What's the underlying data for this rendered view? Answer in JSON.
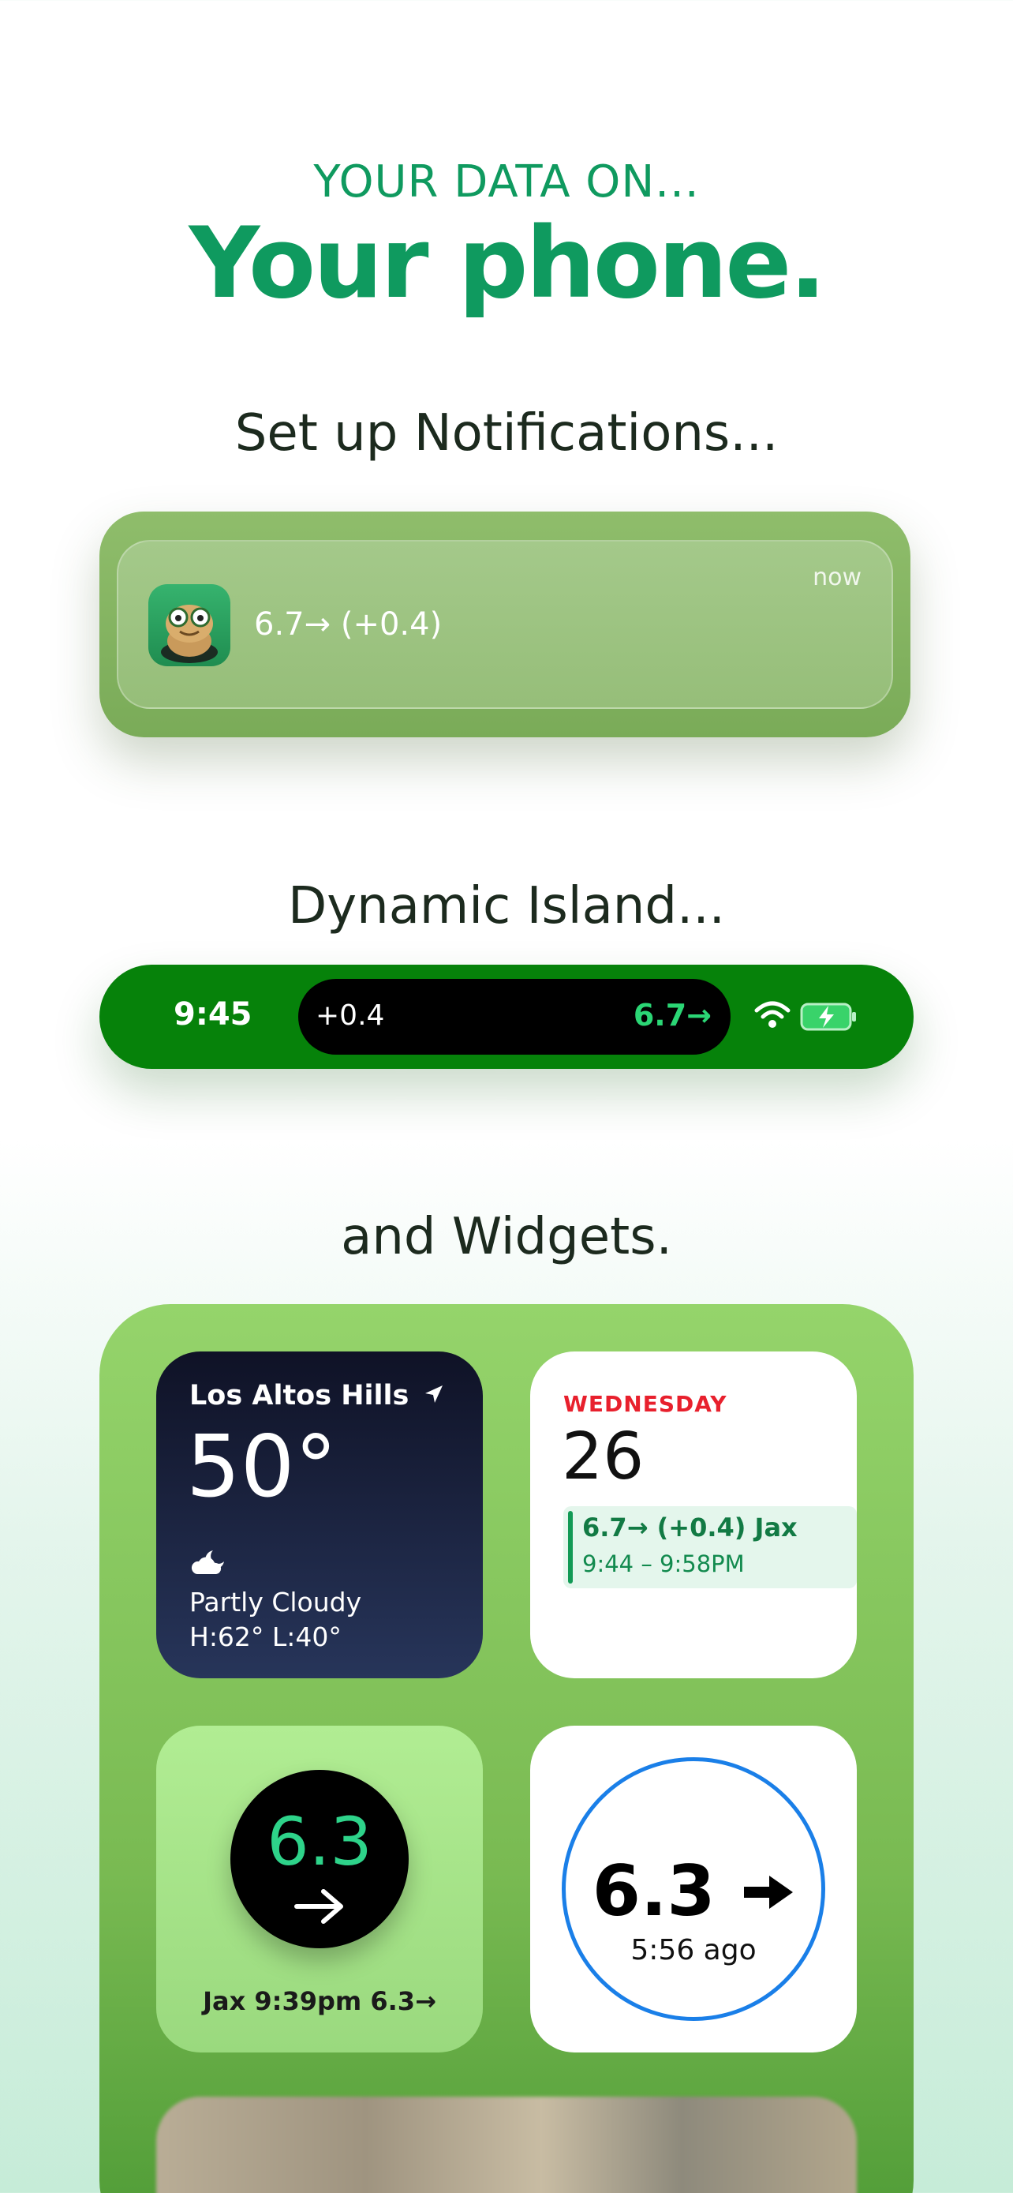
{
  "hero": {
    "kicker": "YOUR DATA ON...",
    "headline": "Your phone."
  },
  "sections": {
    "notifications": "Set up Notifications...",
    "dynamic_island": "Dynamic Island...",
    "widgets": "and Widgets."
  },
  "notification": {
    "app_icon": "frog-mascot-icon",
    "message": "6.7→ (+0.4)",
    "time": "now"
  },
  "island": {
    "clock": "9:45",
    "left_value": "+0.4",
    "right_value": "6.7→",
    "icons": [
      "wifi-icon",
      "battery-charging-icon"
    ]
  },
  "widgets": {
    "weather": {
      "location": "Los Altos Hills",
      "temperature": "50°",
      "condition": "Partly Cloudy",
      "high_low": "H:62° L:40°",
      "icons": [
        "location-arrow-icon",
        "partly-cloudy-night-icon"
      ]
    },
    "calendar": {
      "weekday": "WEDNESDAY",
      "date": "26",
      "event_title": "6.7→ (+0.4) Jax",
      "event_time": "9:44 – 9:58PM"
    },
    "circle": {
      "value": "6.3",
      "caption": "Jax 9:39pm 6.3→"
    },
    "ring": {
      "value": "6.3",
      "ago": "5:56 ago"
    }
  },
  "colors": {
    "brand_green": "#0f9a5f",
    "island_green": "#06820a",
    "accent_bright_green": "#2bd675",
    "calendar_red": "#e8202d",
    "ring_blue": "#1a7fe8"
  }
}
